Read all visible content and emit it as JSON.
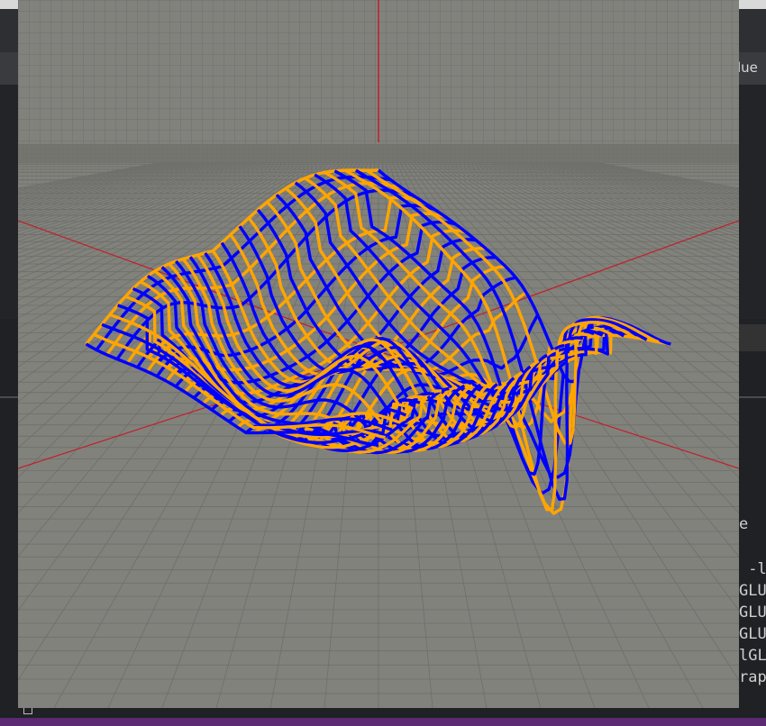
{
  "background_app": {
    "tab_label_fragment": "lue",
    "terminal_lines": [
      "e",
      "",
      " -l",
      "GLU",
      "GLU",
      "GLU",
      "lGL",
      "rap"
    ]
  },
  "viewport": {
    "description_colors": {
      "background": "#82827d",
      "grid_line": "#6a6a66",
      "axis_red": "#c0202a",
      "mesh_line_a": "#0000ff",
      "mesh_line_b": "#ffa500"
    }
  }
}
